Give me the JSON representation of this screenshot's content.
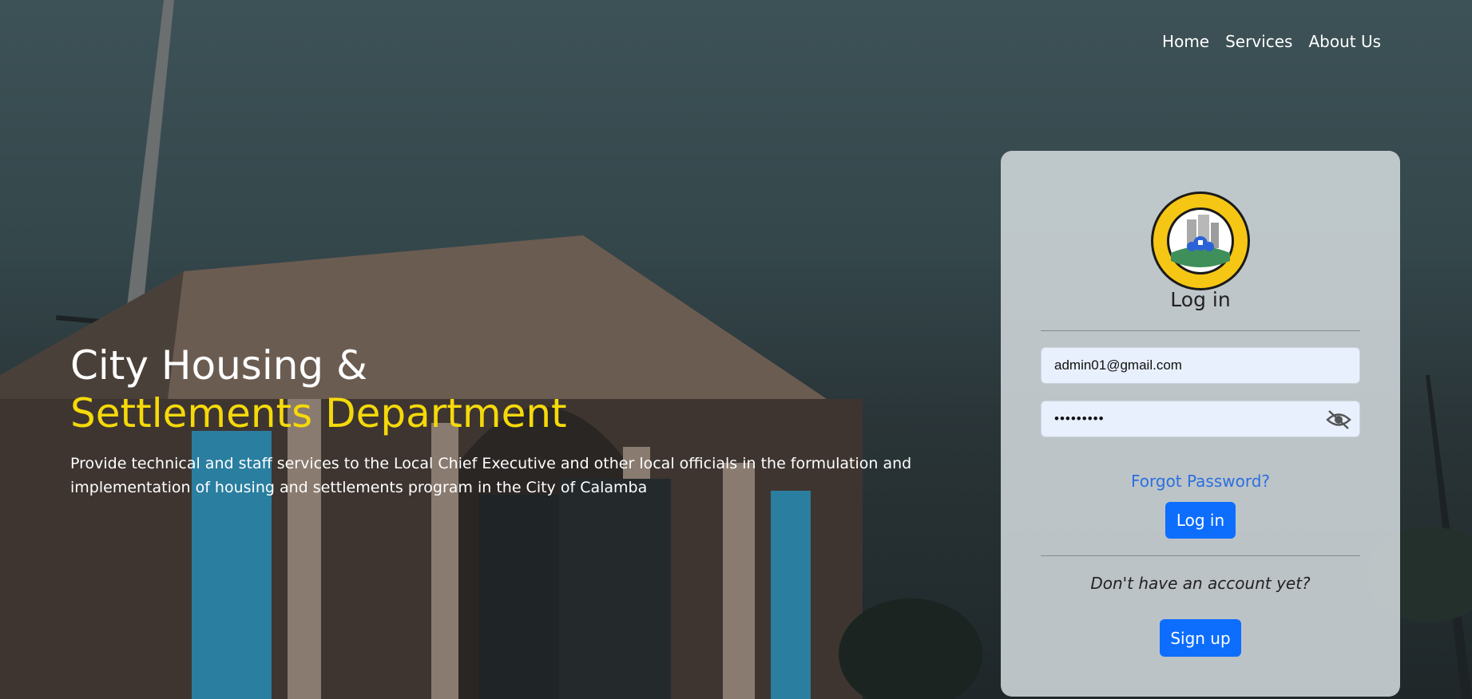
{
  "nav": {
    "items": [
      "Home",
      "Services",
      "About Us"
    ]
  },
  "hero": {
    "title_line1": "City Housing &",
    "title_line2": "Settlements Department",
    "description": "Provide technical and staff services to the Local Chief Executive and other local officials in the formulation and implementation of housing and settlements program in the City of Calamba"
  },
  "login": {
    "logo_icon": "chsd-seal-logo",
    "title": "Log in",
    "email_value": "admin01@gmail.com",
    "password_value": "•••••••••",
    "password_toggle_icon": "eye-slash-icon",
    "forgot_label": "Forgot Password?",
    "login_label": "Log in",
    "no_account_text": "Don't have an account yet?",
    "signup_label": "Sign up"
  },
  "colors": {
    "accent_yellow": "#f5d90a",
    "primary_button": "#0d6efd",
    "link": "#2b6fe0"
  }
}
